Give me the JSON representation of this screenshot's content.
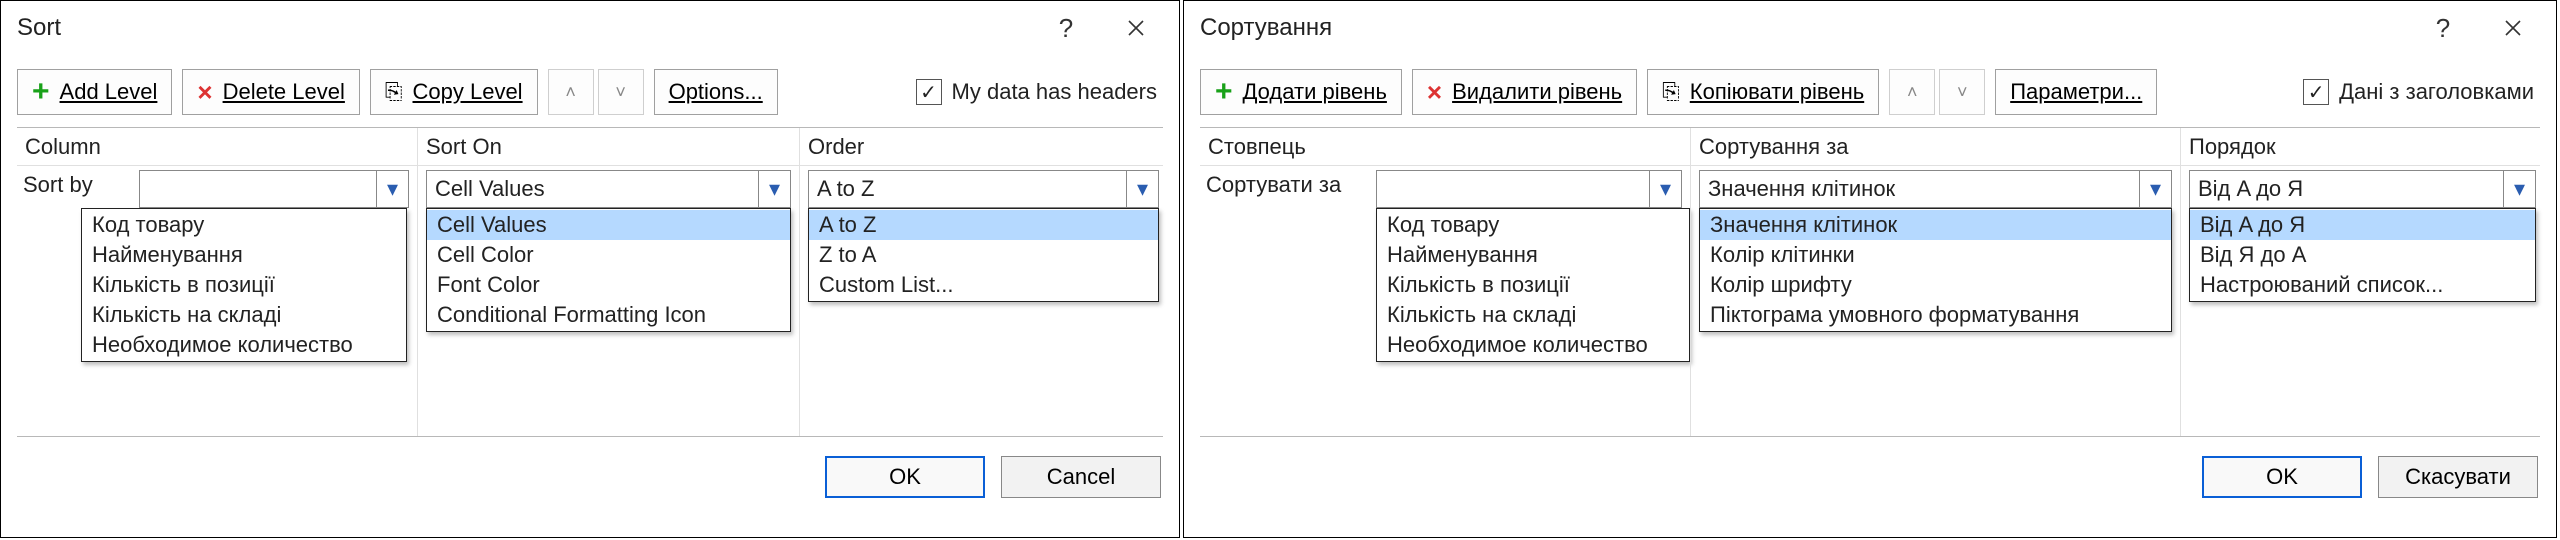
{
  "left": {
    "title": "Sort",
    "toolbar": {
      "add": "Add Level",
      "delete": "Delete Level",
      "copy": "Copy Level",
      "options": "Options...",
      "headers_label": "My data has headers"
    },
    "cols": {
      "column": "Column",
      "sorton": "Sort On",
      "order": "Order"
    },
    "sortby_label": "Sort by",
    "combo": {
      "column": "",
      "sorton": "Cell Values",
      "order": "A to Z"
    },
    "dd_column": [
      "Код товару",
      "Найменування",
      "Кількість в позиції",
      "Кількість на складі",
      "Необходимое количество"
    ],
    "dd_sorton": [
      "Cell Values",
      "Cell Color",
      "Font Color",
      "Conditional Formatting Icon"
    ],
    "dd_order": [
      "A to Z",
      "Z to A",
      "Custom List..."
    ],
    "footer": {
      "ok": "OK",
      "cancel": "Cancel"
    }
  },
  "right": {
    "title": "Сортування",
    "toolbar": {
      "add": "Додати рівень",
      "delete": "Видалити рівень",
      "copy": "Копіювати рівень",
      "options": "Параметри...",
      "headers_label": "Дані з заголовками"
    },
    "cols": {
      "column": "Стовпець",
      "sorton": "Сортування за",
      "order": "Порядок"
    },
    "sortby_label": "Сортувати за",
    "combo": {
      "column": "",
      "sorton": "Значення клітинок",
      "order": "Від A до Я"
    },
    "dd_column": [
      "Код товару",
      "Найменування",
      "Кількість в позиції",
      "Кількість на складі",
      "Необходимое количество"
    ],
    "dd_sorton": [
      "Значення клітинок",
      "Колір клітинки",
      "Колір шрифту",
      "Піктограма умовного форматування"
    ],
    "dd_order": [
      "Від A до Я",
      "Від Я до A",
      "Настроюваний список..."
    ],
    "footer": {
      "ok": "OK",
      "cancel": "Скасувати"
    }
  }
}
